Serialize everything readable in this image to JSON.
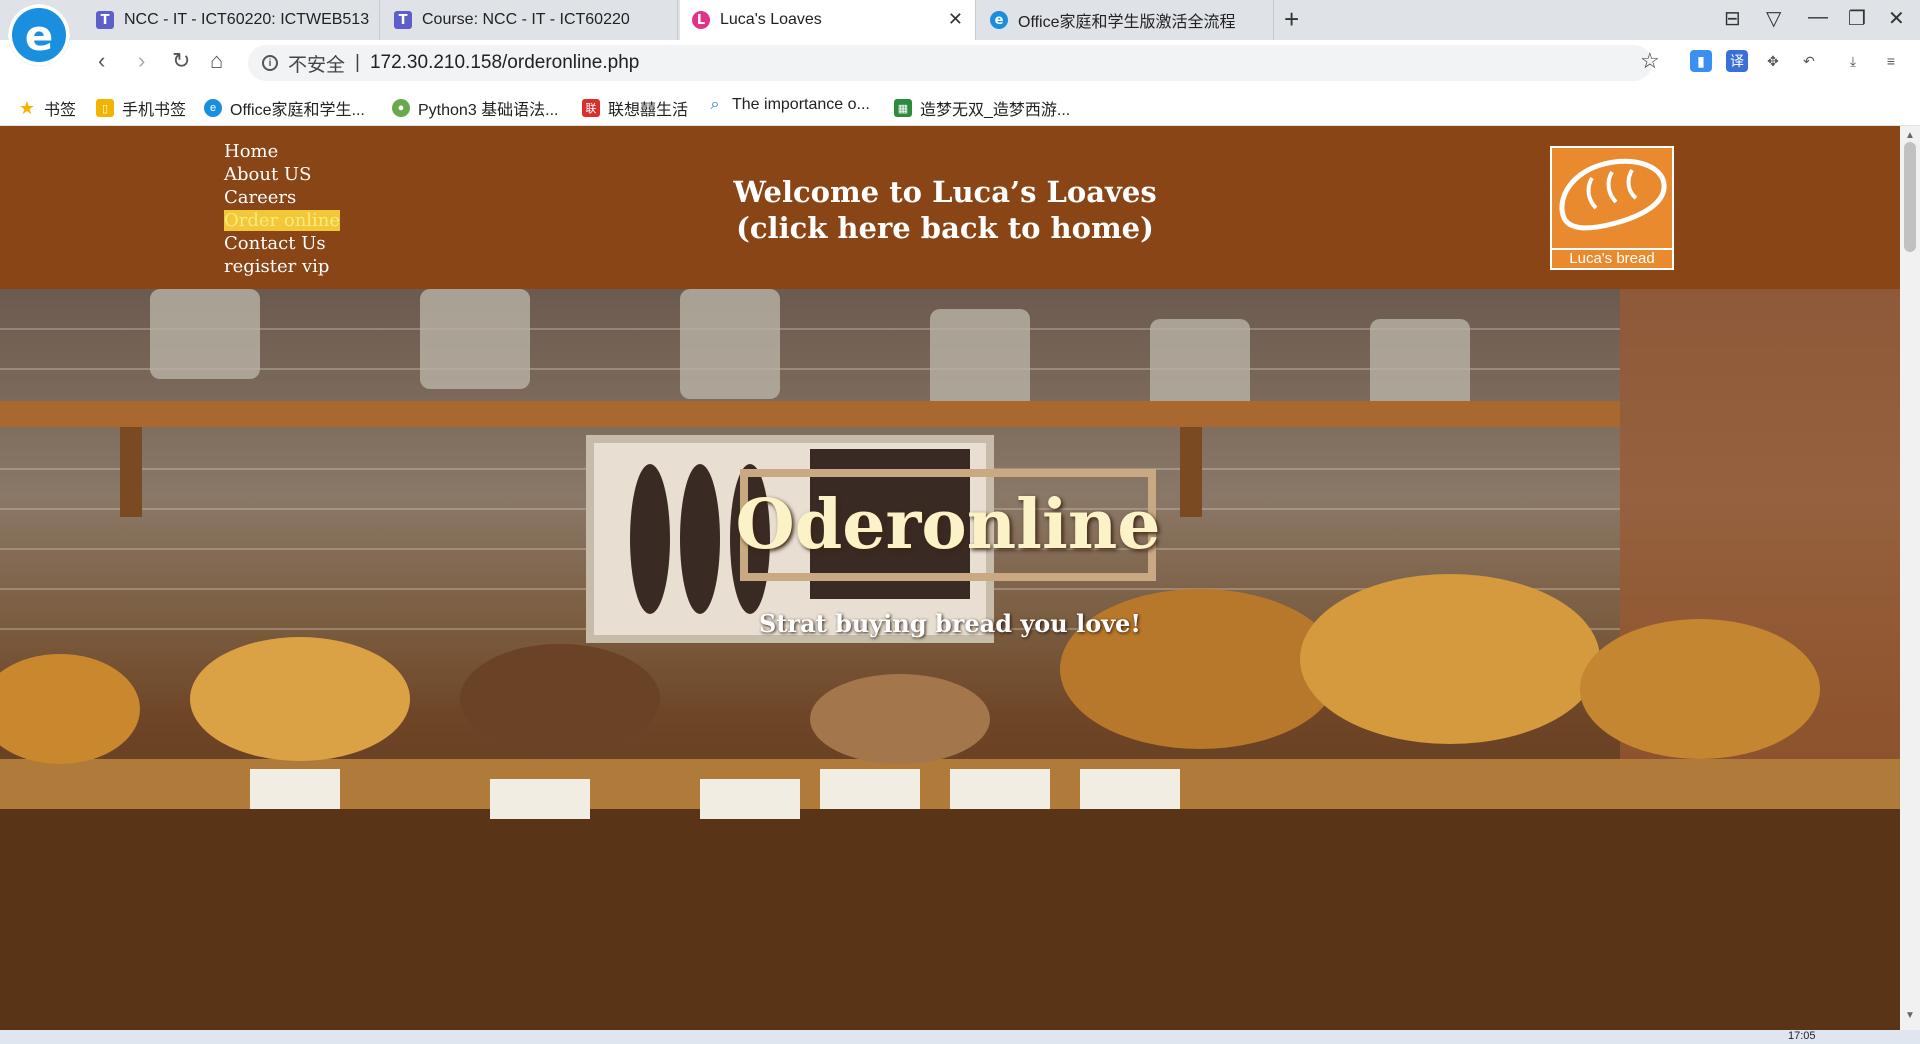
{
  "browser": {
    "logo_glyph": "e",
    "tabs": [
      {
        "title": "NCC - IT - ICT60220: ICTWEB513",
        "icon_glyph": "T",
        "icon_color": "#5b5fc7"
      },
      {
        "title": "Course: NCC - IT - ICT60220",
        "icon_glyph": "T",
        "icon_color": "#5b5fc7"
      },
      {
        "title": "Luca's Loaves",
        "icon_glyph": "L",
        "icon_color": "#e0338a"
      },
      {
        "title": "Office家庭和学生版激活全流程",
        "icon_glyph": "e",
        "icon_color": "#1a8fe0"
      }
    ],
    "new_tab_glyph": "+",
    "close_glyph": "✕",
    "address": {
      "security_label": "不安全",
      "separator": "|",
      "url": "172.30.210.158/orderonline.php"
    },
    "bookmarks": [
      {
        "label": "书签",
        "icon": "star-icon",
        "color": "#f2b400"
      },
      {
        "label": "手机书签",
        "icon": "phone-icon",
        "color": "#f2b400"
      },
      {
        "label": "Office家庭和学生...",
        "icon": "browser-e-icon",
        "color": "#1a8fe0"
      },
      {
        "label": "Python3 基础语法...",
        "icon": "python-icon",
        "color": "#6aa84f"
      },
      {
        "label": "联想囍生活",
        "icon": "lenovo-icon",
        "color": "#d9302c"
      },
      {
        "label": "The importance o...",
        "icon": "search-icon",
        "color": "#1a73e8"
      },
      {
        "label": "造梦无双_造梦西游...",
        "icon": "game-icon",
        "color": "#2e8b3d"
      }
    ]
  },
  "site": {
    "nav": [
      {
        "label": "Home",
        "active": false
      },
      {
        "label": "About US",
        "active": false
      },
      {
        "label": "Careers",
        "active": false
      },
      {
        "label": "Order online",
        "active": true
      },
      {
        "label": "Contact Us",
        "active": false
      },
      {
        "label": "register vip",
        "active": false
      }
    ],
    "welcome_line1": "Welcome to Luca’s Loaves",
    "welcome_line2": "(click here back to home)",
    "logo_caption": "Luca's bread",
    "hero_title": "Oderonline",
    "hero_subtitle": "Strat buying bread you love!",
    "header_color": "#8a4516",
    "accent_color": "#f2c73a"
  },
  "taskbar": {
    "clock": "17:05"
  }
}
